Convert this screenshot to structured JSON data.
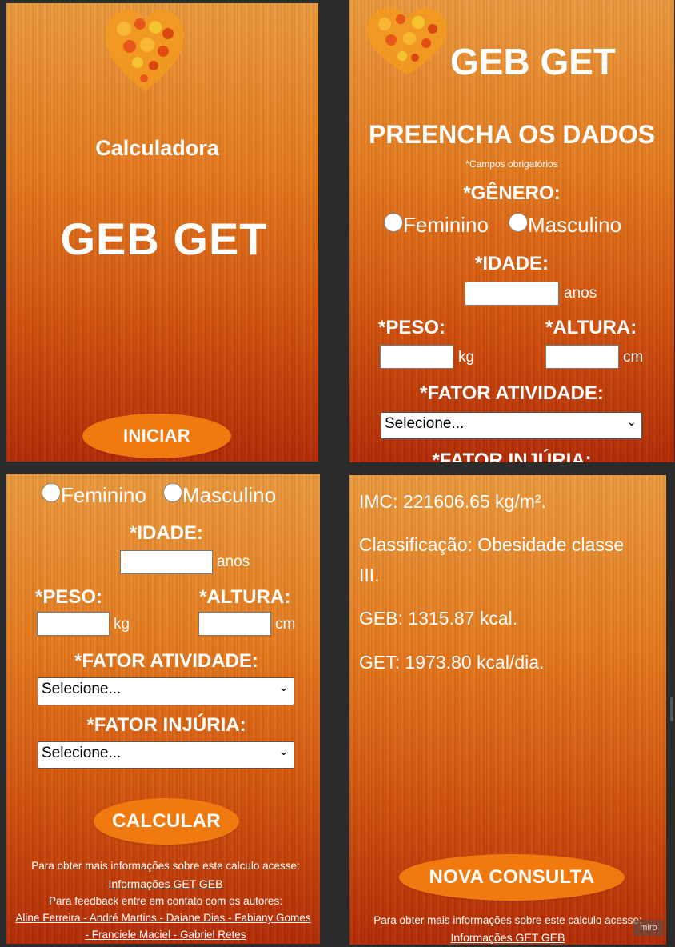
{
  "screen1": {
    "subtitle": "Calculadora",
    "title": "GEB GET",
    "start_button": "INICIAR"
  },
  "screen2": {
    "brand": "GEB GET",
    "heading": "PREENCHA OS DADOS",
    "required_note": "*Campos obrigatórios",
    "gender_label": "*GÊNERO:",
    "female": "Feminino",
    "male": "Masculino",
    "age_label": "*IDADE:",
    "age_unit": "anos",
    "weight_label": "*PESO:",
    "weight_unit": "kg",
    "height_label": "*ALTURA:",
    "height_unit": "cm",
    "activity_label": "*FATOR ATIVIDADE:",
    "activity_value": "Selecione...",
    "injury_label": "*FATOR INJÚRIA:"
  },
  "screen3": {
    "female": "Feminino",
    "male": "Masculino",
    "age_label": "*IDADE:",
    "age_unit": "anos",
    "weight_label": "*PESO:",
    "weight_unit": "kg",
    "height_label": "*ALTURA:",
    "height_unit": "cm",
    "activity_label": "*FATOR ATIVIDADE:",
    "activity_value": "Selecione...",
    "injury_label": "*FATOR INJÚRIA:",
    "injury_value": "Selecione...",
    "calculate_button": "CALCULAR",
    "info_text": "Para obter mais informações sobre este calculo acesse:",
    "info_link": "Informações GET GEB",
    "feedback_text": "Para feedback entre em contato com os autores:",
    "authors_line1": "Aline Ferreira - André Martins - Daiane Dias - Fabiany Gomes",
    "authors_line2": "- Franciele Maciel - Gabriel Retes"
  },
  "screen4": {
    "imc": "IMC: 221606.65 kg/m².",
    "classification_line1": "Classificação: Obesidade classe",
    "classification_line2": "III.",
    "geb": "GEB: 1315.87 kcal.",
    "get": "GET: 1973.80 kcal/dia.",
    "new_button": "NOVA CONSULTA",
    "info_text": "Para obter mais informações sobre este calculo acesse:",
    "info_link": "Informações GET GEB",
    "watermark": "miro"
  },
  "colors": {
    "button": "#f07a10",
    "background_top": "#f0a245",
    "background_bottom": "#b22908"
  },
  "icons": [
    "fruit-heart-logo-icon",
    "chevron-down-icon"
  ]
}
